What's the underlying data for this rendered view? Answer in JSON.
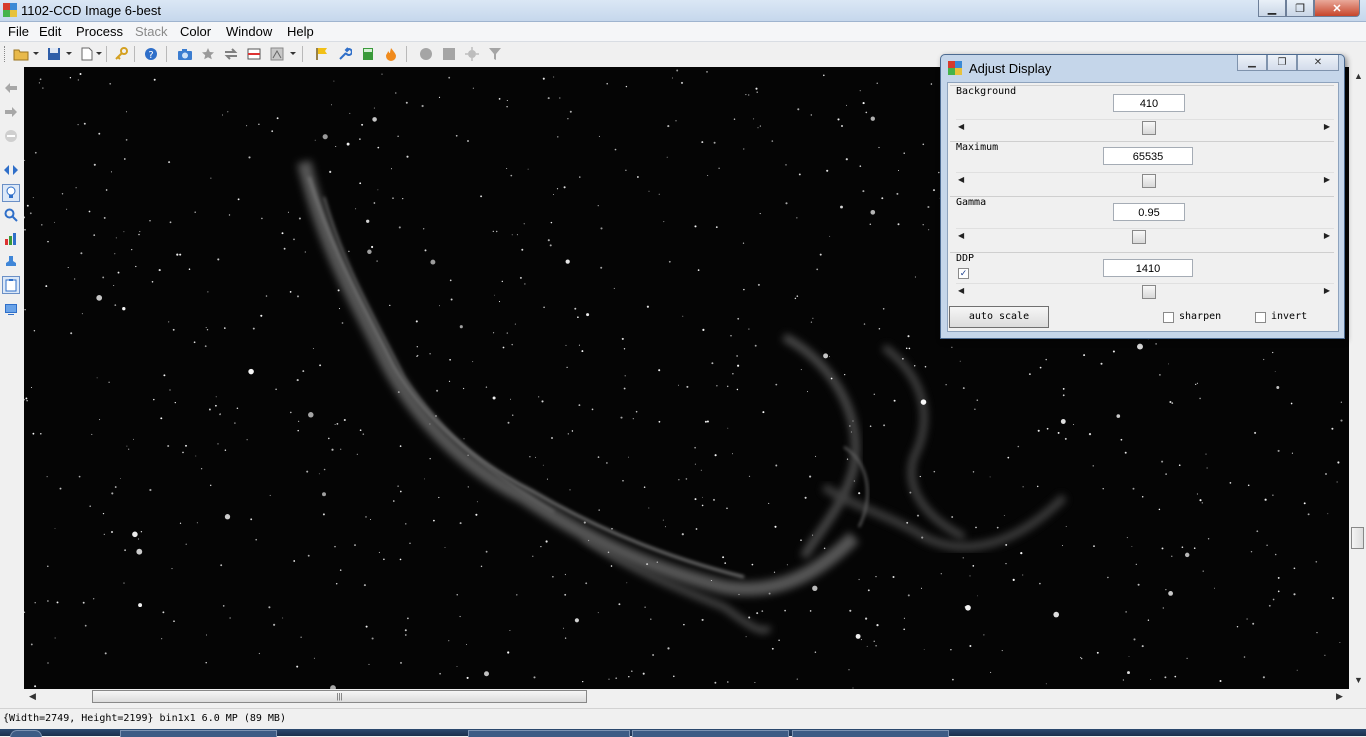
{
  "window": {
    "title": "1102-CCD Image 6-best",
    "minimize": "▁",
    "restore": "❐",
    "close": "✕"
  },
  "menu": [
    "File",
    "Edit",
    "Process",
    "Stack",
    "Color",
    "Window",
    "Help"
  ],
  "menu_disabled": [
    "Stack"
  ],
  "toolbar": {
    "icons": [
      "open-folder-icon",
      "save-icon",
      "new-document-icon",
      "key-icon",
      "help-icon",
      "camera-icon",
      "star-icon",
      "swap-icon",
      "color-bar-icon",
      "histogram-icon",
      "flag-icon",
      "wrench-icon",
      "calculator-icon",
      "flame-icon",
      "circle-icon",
      "square-icon",
      "burst-icon",
      "funnel-icon"
    ]
  },
  "left_tools": [
    "back-arrow-icon",
    "forward-arrow-icon",
    "stop-icon",
    "move-arrows-icon",
    "lightbulb-icon",
    "magnifier-icon",
    "bar-chart-icon",
    "stamp-icon",
    "clipboard-icon",
    "display-icon"
  ],
  "status": {
    "text": "{Width=2749, Height=2199} bin1x1  6.0 MP (89 MB)"
  },
  "hscroll": {
    "grip": "|||"
  },
  "dialog": {
    "title": "Adjust Display",
    "background": {
      "label": "Background",
      "value": "410",
      "slider_fraction": 0.5
    },
    "maximum": {
      "label": "Maximum",
      "value": "65535",
      "slider_fraction": 0.5
    },
    "gamma": {
      "label": "Gamma",
      "value": "0.95",
      "slider_fraction": 0.47
    },
    "ddp": {
      "label": "DDP",
      "value": "1410",
      "checked": true,
      "slider_fraction": 0.5
    },
    "auto_scale": "auto scale",
    "sharpen": {
      "label": "sharpen",
      "checked": false
    },
    "invert": {
      "label": "invert",
      "checked": false
    }
  },
  "colors": {
    "title_bg": "#c6d7ec",
    "image_bg": "#050505",
    "dialog_frame": "#c5d6ea",
    "accent_blue": "#2f6fc9"
  }
}
